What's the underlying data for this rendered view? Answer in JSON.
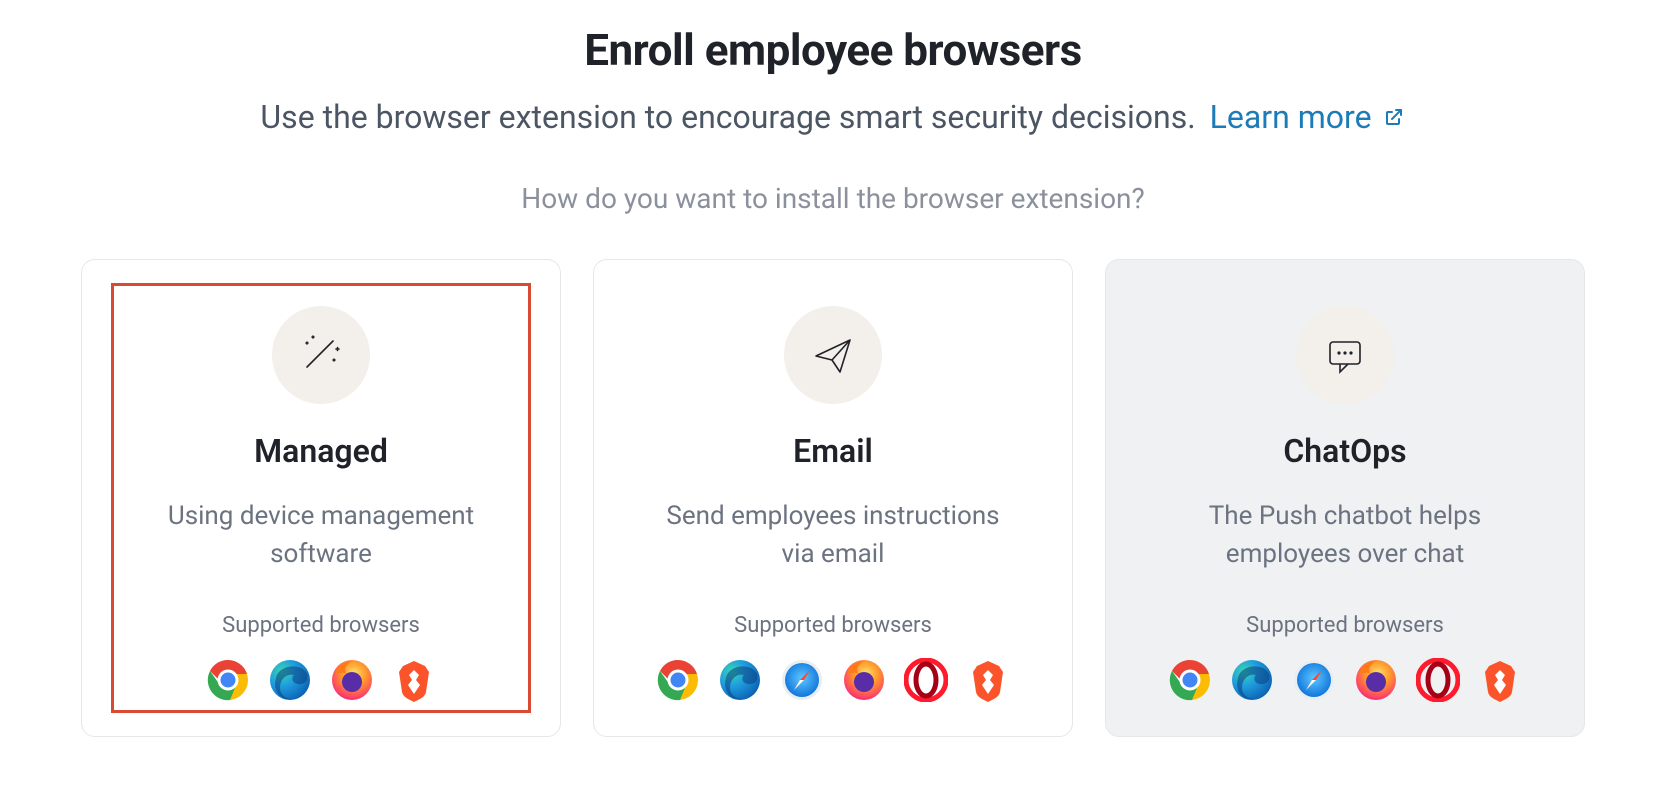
{
  "heading": {
    "title": "Enroll employee browsers",
    "subtitle": "Use the browser extension to encourage smart security decisions.",
    "learn_more": "Learn more",
    "prompt": "How do you want to install the browser extension?"
  },
  "cards": [
    {
      "id": "managed",
      "title": "Managed",
      "description": "Using device management software",
      "supported_label": "Supported browsers",
      "highlighted": true,
      "disabled": false,
      "icon": "wand-icon",
      "browsers": [
        "chrome",
        "edge",
        "firefox",
        "brave"
      ]
    },
    {
      "id": "email",
      "title": "Email",
      "description": "Send employees instructions via email",
      "supported_label": "Supported browsers",
      "highlighted": false,
      "disabled": false,
      "icon": "paper-plane-icon",
      "browsers": [
        "chrome",
        "edge",
        "safari",
        "firefox",
        "opera",
        "brave"
      ]
    },
    {
      "id": "chatops",
      "title": "ChatOps",
      "description": "The Push chatbot helps employees over chat",
      "supported_label": "Supported browsers",
      "highlighted": false,
      "disabled": true,
      "icon": "chat-icon",
      "browsers": [
        "chrome",
        "edge",
        "safari",
        "firefox",
        "opera",
        "brave"
      ]
    }
  ]
}
